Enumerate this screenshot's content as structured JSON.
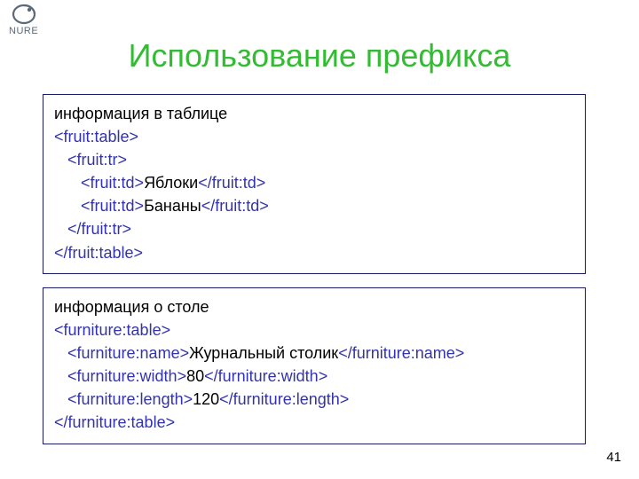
{
  "logo_text": "NURE",
  "title": "Использование префикса",
  "box1": {
    "caption": "информация в таблице",
    "l1o": "<fruit:table>",
    "l2o": "   <fruit:tr>",
    "l3o": "      <fruit:td>",
    "l3t": "Яблоки",
    "l3c": "</fruit:td>",
    "l4o": "      <fruit:td>",
    "l4t": "Бананы",
    "l4c": "</fruit:td>",
    "l5c": "   </fruit:tr>",
    "l6c": "</fruit:table>"
  },
  "box2": {
    "caption": "информация о столе",
    "l1o": "<furniture:table>",
    "l2o": "   <furniture:name>",
    "l2t": "Журнальный столик",
    "l2c": "</furniture:name>",
    "l3o": "   <furniture:width>",
    "l3t": "80",
    "l3c": "</furniture:width>",
    "l4o": "   <furniture:length>",
    "l4t": "120",
    "l4c": "</furniture:length>",
    "l5c": "</furniture:table>"
  },
  "page_number": "41"
}
